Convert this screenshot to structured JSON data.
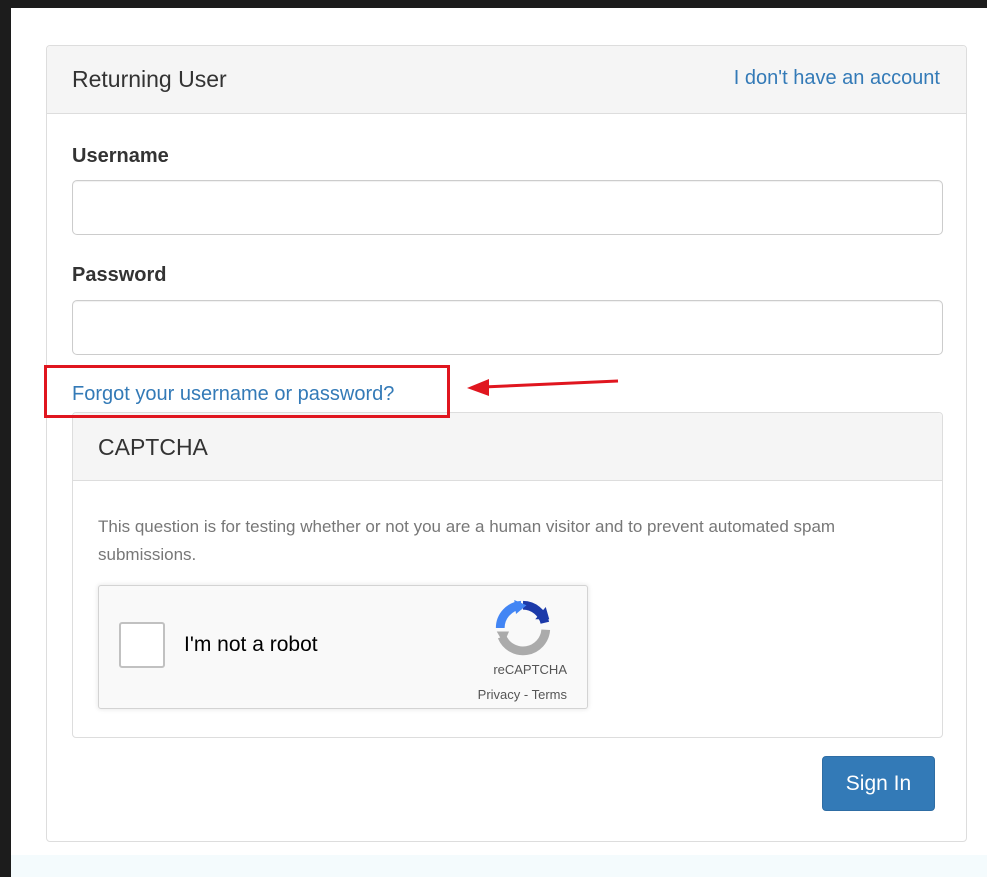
{
  "header": {
    "title": "Returning User",
    "no_account_link": "I don't have an account"
  },
  "form": {
    "username_label": "Username",
    "username_value": "",
    "password_label": "Password",
    "password_value": "",
    "forgot_link": "Forgot your username or password?"
  },
  "captcha": {
    "title": "CAPTCHA",
    "description": "This question is for testing whether or not you are a human visitor and to prevent automated spam submissions.",
    "checkbox_label": "I'm not a robot",
    "checked": false,
    "brand": "reCAPTCHA",
    "privacy_link": "Privacy",
    "separator": " - ",
    "terms_link": "Terms",
    "logo_icon": "recaptcha-logo-icon"
  },
  "actions": {
    "sign_in_label": "Sign In"
  },
  "annotation": {
    "highlight_color": "#e0161f",
    "arrow_icon": "red-arrow-left-icon"
  },
  "colors": {
    "link": "#337ab7",
    "primary_button": "#337ab7",
    "panel_heading_bg": "#f5f5f5",
    "border": "#dddddd"
  }
}
